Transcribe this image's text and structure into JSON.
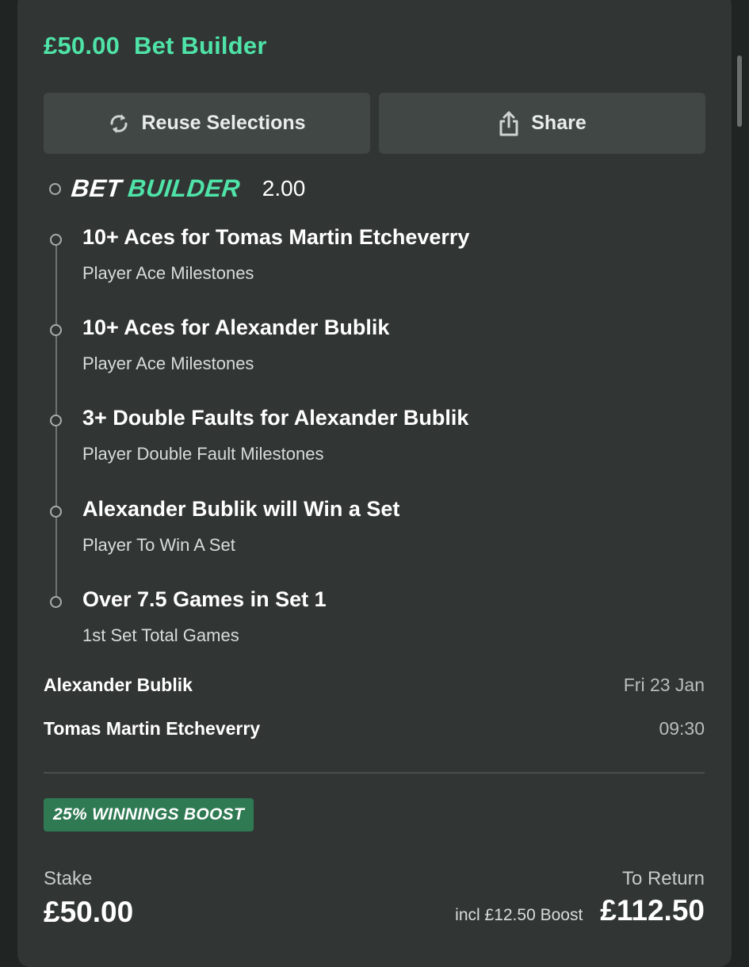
{
  "bet": {
    "stake_amount": "£50.00",
    "type_label": "Bet Builder"
  },
  "actions": {
    "reuse_label": "Reuse Selections",
    "share_label": "Share"
  },
  "bet_builder": {
    "logo_word1": "BET",
    "logo_word2": "BUILDER",
    "odds": "2.00",
    "legs": [
      {
        "title": "10+ Aces for Tomas Martin Etcheverry",
        "market": "Player Ace Milestones"
      },
      {
        "title": "10+ Aces for Alexander Bublik",
        "market": "Player Ace Milestones"
      },
      {
        "title": "3+ Double Faults for Alexander Bublik",
        "market": "Player Double Fault Milestones"
      },
      {
        "title": "Alexander Bublik will Win a Set",
        "market": "Player To Win A Set"
      },
      {
        "title": "Over 7.5 Games in Set 1",
        "market": "1st Set Total Games"
      }
    ]
  },
  "event": {
    "player1": "Alexander Bublik",
    "date": "Fri 23 Jan",
    "player2": "Tomas Martin Etcheverry",
    "time": "09:30"
  },
  "boost": {
    "badge": "25% WINNINGS BOOST"
  },
  "summary": {
    "stake_label": "Stake",
    "stake_value": "£50.00",
    "return_label": "To Return",
    "boost_note": "incl £12.50 Boost",
    "return_value": "£112.50"
  },
  "colors": {
    "accent_green": "#4fe3a8",
    "boost_badge": "#2f7a53",
    "card_bg": "#313634"
  },
  "icons": {
    "reuse": "refresh-icon",
    "share": "share-icon"
  }
}
